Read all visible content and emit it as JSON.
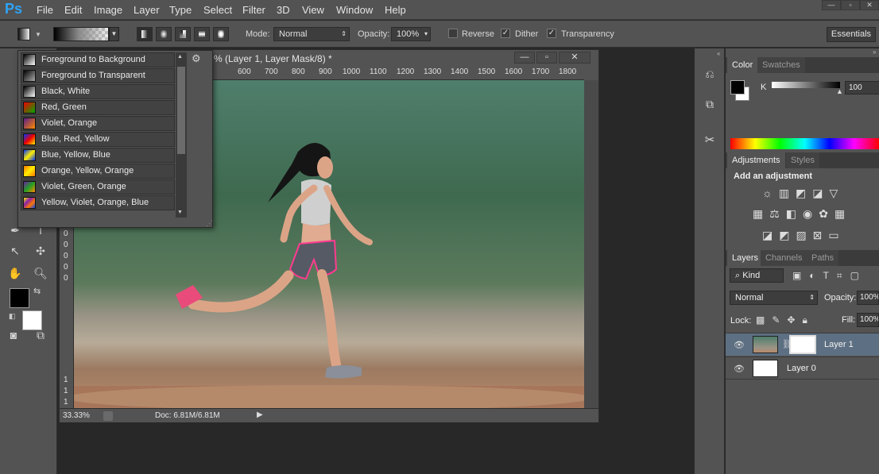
{
  "app": {
    "logo": "Ps"
  },
  "menu": [
    "File",
    "Edit",
    "Image",
    "Layer",
    "Type",
    "Select",
    "Filter",
    "3D",
    "View",
    "Window",
    "Help"
  ],
  "window_controls": {
    "minimize": "—",
    "restore": "▫",
    "close": "✕"
  },
  "options": {
    "mode_label": "Mode:",
    "mode_value": "Normal",
    "opacity_label": "Opacity:",
    "opacity_value": "100%",
    "reverse_label": "Reverse",
    "dither_label": "Dither",
    "transparency_label": "Transparency",
    "workspace": "Essentials"
  },
  "document": {
    "title": "% (Layer 1, Layer Mask/8) *",
    "ruler_top": [
      "600",
      "700",
      "800",
      "900",
      "1000",
      "1100",
      "1200",
      "1300",
      "1400",
      "1500",
      "1600",
      "1700",
      "1800"
    ],
    "ruler_left": [
      "0",
      "0",
      "0",
      "0",
      "0",
      "1",
      "1",
      "1",
      "1",
      "1"
    ],
    "zoom": "33.33%",
    "doc_size": "Doc: 6.81M/6.81M"
  },
  "gradient_picker": {
    "items": [
      {
        "label": "Foreground to Background",
        "swatch": "linear-gradient(135deg,#000 0%,#fff 100%)"
      },
      {
        "label": "Foreground to Transparent",
        "swatch": "linear-gradient(135deg,#000 0%,#aaa 100%)"
      },
      {
        "label": "Black, White",
        "swatch": "linear-gradient(135deg,#000 0%,#fff 100%)"
      },
      {
        "label": "Red, Green",
        "swatch": "linear-gradient(135deg,#e00 0%,#0a0 100%)"
      },
      {
        "label": "Violet, Orange",
        "swatch": "linear-gradient(135deg,#5a1d8a 0%,#ff8a00 100%)"
      },
      {
        "label": "Blue, Red, Yellow",
        "swatch": "linear-gradient(135deg,#0033ff 0%,#ee0000 50%,#ffee00 100%)"
      },
      {
        "label": "Blue, Yellow, Blue",
        "swatch": "linear-gradient(135deg,#0033ff 0%,#ffee00 50%,#0033ff 100%)"
      },
      {
        "label": "Orange, Yellow, Orange",
        "swatch": "linear-gradient(135deg,#ff7700 0%,#ffee00 50%,#ff7700 100%)"
      },
      {
        "label": "Violet, Green, Orange",
        "swatch": "linear-gradient(135deg,#6a1fa0 0%,#23a023 50%,#ff8a00 100%)"
      },
      {
        "label": "Yellow, Violet, Orange, Blue",
        "swatch": "linear-gradient(135deg,#ffee00 0%,#8a1fb0 35%,#ff7700 65%,#0044ff 100%)"
      }
    ]
  },
  "color_panel": {
    "tabs": [
      "Color",
      "Swatches"
    ],
    "channel_label": "K",
    "channel_value": "100"
  },
  "adjustments_panel": {
    "tabs": [
      "Adjustments",
      "Styles"
    ],
    "heading": "Add an adjustment"
  },
  "layers_panel": {
    "tabs": [
      "Layers",
      "Channels",
      "Paths"
    ],
    "filter_kind": "Kind",
    "blend_mode": "Normal",
    "opacity_label": "Opacity:",
    "opacity_value": "100%",
    "lock_label": "Lock:",
    "fill_label": "Fill:",
    "fill_value": "100%",
    "layers": [
      {
        "name": "Layer 1",
        "selected": true
      },
      {
        "name": "Layer 0",
        "selected": false
      }
    ]
  },
  "colors": {
    "accent": "#2fa3f6",
    "panel": "#535353",
    "dark": "#282828"
  }
}
